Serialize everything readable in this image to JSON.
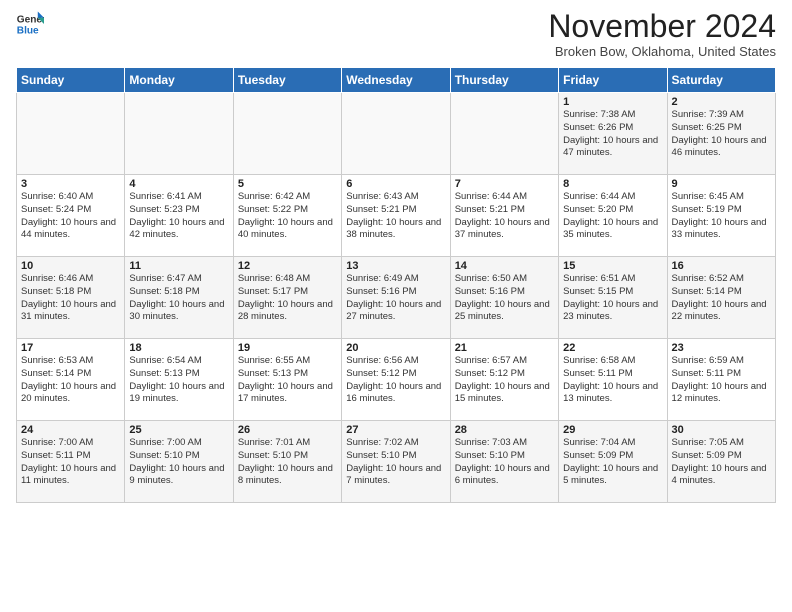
{
  "logo": {
    "line1": "General",
    "line2": "Blue"
  },
  "title": "November 2024",
  "subtitle": "Broken Bow, Oklahoma, United States",
  "headers": [
    "Sunday",
    "Monday",
    "Tuesday",
    "Wednesday",
    "Thursday",
    "Friday",
    "Saturday"
  ],
  "weeks": [
    [
      {
        "day": "",
        "info": ""
      },
      {
        "day": "",
        "info": ""
      },
      {
        "day": "",
        "info": ""
      },
      {
        "day": "",
        "info": ""
      },
      {
        "day": "",
        "info": ""
      },
      {
        "day": "1",
        "info": "Sunrise: 7:38 AM\nSunset: 6:26 PM\nDaylight: 10 hours and 47 minutes."
      },
      {
        "day": "2",
        "info": "Sunrise: 7:39 AM\nSunset: 6:25 PM\nDaylight: 10 hours and 46 minutes."
      }
    ],
    [
      {
        "day": "3",
        "info": "Sunrise: 6:40 AM\nSunset: 5:24 PM\nDaylight: 10 hours and 44 minutes."
      },
      {
        "day": "4",
        "info": "Sunrise: 6:41 AM\nSunset: 5:23 PM\nDaylight: 10 hours and 42 minutes."
      },
      {
        "day": "5",
        "info": "Sunrise: 6:42 AM\nSunset: 5:22 PM\nDaylight: 10 hours and 40 minutes."
      },
      {
        "day": "6",
        "info": "Sunrise: 6:43 AM\nSunset: 5:21 PM\nDaylight: 10 hours and 38 minutes."
      },
      {
        "day": "7",
        "info": "Sunrise: 6:44 AM\nSunset: 5:21 PM\nDaylight: 10 hours and 37 minutes."
      },
      {
        "day": "8",
        "info": "Sunrise: 6:44 AM\nSunset: 5:20 PM\nDaylight: 10 hours and 35 minutes."
      },
      {
        "day": "9",
        "info": "Sunrise: 6:45 AM\nSunset: 5:19 PM\nDaylight: 10 hours and 33 minutes."
      }
    ],
    [
      {
        "day": "10",
        "info": "Sunrise: 6:46 AM\nSunset: 5:18 PM\nDaylight: 10 hours and 31 minutes."
      },
      {
        "day": "11",
        "info": "Sunrise: 6:47 AM\nSunset: 5:18 PM\nDaylight: 10 hours and 30 minutes."
      },
      {
        "day": "12",
        "info": "Sunrise: 6:48 AM\nSunset: 5:17 PM\nDaylight: 10 hours and 28 minutes."
      },
      {
        "day": "13",
        "info": "Sunrise: 6:49 AM\nSunset: 5:16 PM\nDaylight: 10 hours and 27 minutes."
      },
      {
        "day": "14",
        "info": "Sunrise: 6:50 AM\nSunset: 5:16 PM\nDaylight: 10 hours and 25 minutes."
      },
      {
        "day": "15",
        "info": "Sunrise: 6:51 AM\nSunset: 5:15 PM\nDaylight: 10 hours and 23 minutes."
      },
      {
        "day": "16",
        "info": "Sunrise: 6:52 AM\nSunset: 5:14 PM\nDaylight: 10 hours and 22 minutes."
      }
    ],
    [
      {
        "day": "17",
        "info": "Sunrise: 6:53 AM\nSunset: 5:14 PM\nDaylight: 10 hours and 20 minutes."
      },
      {
        "day": "18",
        "info": "Sunrise: 6:54 AM\nSunset: 5:13 PM\nDaylight: 10 hours and 19 minutes."
      },
      {
        "day": "19",
        "info": "Sunrise: 6:55 AM\nSunset: 5:13 PM\nDaylight: 10 hours and 17 minutes."
      },
      {
        "day": "20",
        "info": "Sunrise: 6:56 AM\nSunset: 5:12 PM\nDaylight: 10 hours and 16 minutes."
      },
      {
        "day": "21",
        "info": "Sunrise: 6:57 AM\nSunset: 5:12 PM\nDaylight: 10 hours and 15 minutes."
      },
      {
        "day": "22",
        "info": "Sunrise: 6:58 AM\nSunset: 5:11 PM\nDaylight: 10 hours and 13 minutes."
      },
      {
        "day": "23",
        "info": "Sunrise: 6:59 AM\nSunset: 5:11 PM\nDaylight: 10 hours and 12 minutes."
      }
    ],
    [
      {
        "day": "24",
        "info": "Sunrise: 7:00 AM\nSunset: 5:11 PM\nDaylight: 10 hours and 11 minutes."
      },
      {
        "day": "25",
        "info": "Sunrise: 7:00 AM\nSunset: 5:10 PM\nDaylight: 10 hours and 9 minutes."
      },
      {
        "day": "26",
        "info": "Sunrise: 7:01 AM\nSunset: 5:10 PM\nDaylight: 10 hours and 8 minutes."
      },
      {
        "day": "27",
        "info": "Sunrise: 7:02 AM\nSunset: 5:10 PM\nDaylight: 10 hours and 7 minutes."
      },
      {
        "day": "28",
        "info": "Sunrise: 7:03 AM\nSunset: 5:10 PM\nDaylight: 10 hours and 6 minutes."
      },
      {
        "day": "29",
        "info": "Sunrise: 7:04 AM\nSunset: 5:09 PM\nDaylight: 10 hours and 5 minutes."
      },
      {
        "day": "30",
        "info": "Sunrise: 7:05 AM\nSunset: 5:09 PM\nDaylight: 10 hours and 4 minutes."
      }
    ]
  ]
}
